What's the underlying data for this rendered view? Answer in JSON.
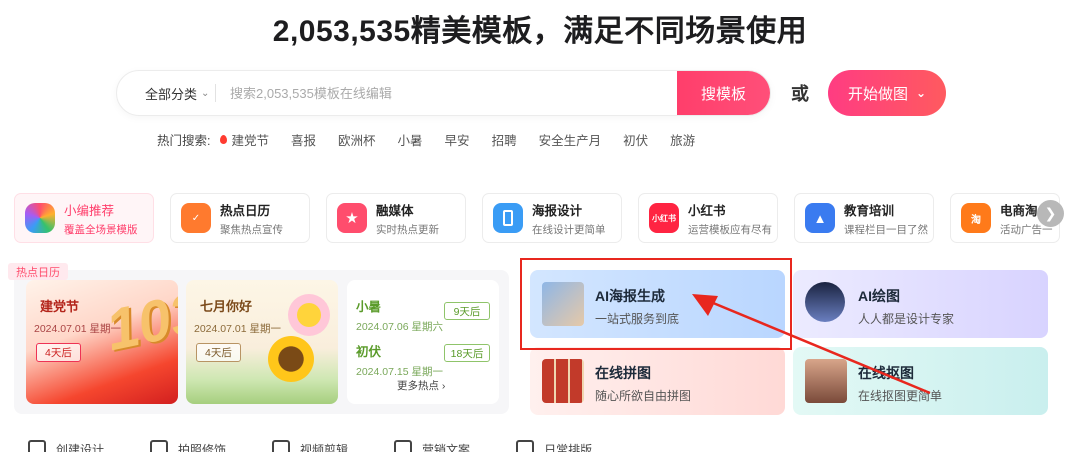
{
  "headline": "2,053,535精美模板，满足不同场景使用",
  "search": {
    "category_label": "全部分类",
    "placeholder": "搜索2,053,535模板在线编辑",
    "value": "",
    "button_label": "搜模板"
  },
  "or_text": "或",
  "start_button": "开始做图",
  "hot_search": {
    "label": "热门搜索:",
    "keywords": [
      "建党节",
      "喜报",
      "欧洲杯",
      "小暑",
      "早安",
      "招聘",
      "安全生产月",
      "初伏",
      "旅游"
    ]
  },
  "categories": [
    {
      "title": "小编推荐",
      "sub": "覆盖全场景模版",
      "icon": "rainbow-blob-icon",
      "color": "#ff5a7a"
    },
    {
      "title": "热点日历",
      "sub": "聚焦热点宣传",
      "icon": "calendar-icon",
      "color": "#ff7a2e"
    },
    {
      "title": "融媒体",
      "sub": "实时热点更新",
      "icon": "star-icon",
      "color": "#ff4d6d"
    },
    {
      "title": "海报设计",
      "sub": "在线设计更简单",
      "icon": "phone-poster-icon",
      "color": "#3a9cf5"
    },
    {
      "title": "小红书",
      "sub": "运营模板应有尽有",
      "icon": "xiaohongshu-icon",
      "color": "#ff2442"
    },
    {
      "title": "教育培训",
      "sub": "课程栏目一目了然",
      "icon": "graduation-cap-icon",
      "color": "#3a7bf0"
    },
    {
      "title": "电商淘",
      "sub": "活动广告一",
      "icon": "taobao-icon",
      "color": "#ff7a1a"
    }
  ],
  "calendar": {
    "tag": "热点日历",
    "events": [
      {
        "title": "建党节",
        "date": "2024.07.01 星期一",
        "days": "4天后"
      },
      {
        "title": "七月你好",
        "date": "2024.07.01 星期一",
        "days": "4天后"
      }
    ],
    "small_events": [
      {
        "title": "小暑",
        "date": "2024.07.06 星期六",
        "days": "9天后"
      },
      {
        "title": "初伏",
        "date": "2024.07.15 星期一",
        "days": "18天后"
      }
    ],
    "more": "更多热点"
  },
  "features": [
    {
      "title": "AI海报生成",
      "sub": "一站式服务到底"
    },
    {
      "title": "AI绘图",
      "sub": "人人都是设计专家"
    },
    {
      "title": "在线拼图",
      "sub": "随心所欲自由拼图"
    },
    {
      "title": "在线抠图",
      "sub": "在线抠图更简单"
    }
  ],
  "bottom_items": [
    "创建设计",
    "拍照修饰",
    "视频剪辑",
    "营销文案",
    "日常排版"
  ],
  "colors": {
    "accent": "#ff3e6b",
    "annotation": "#e8271e"
  }
}
